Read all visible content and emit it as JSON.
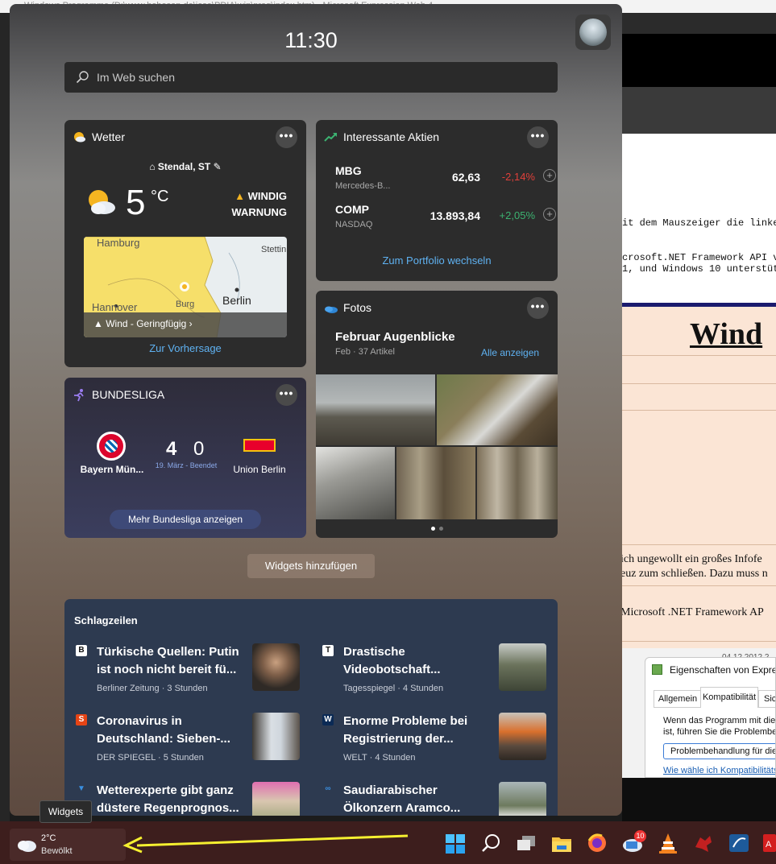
{
  "background_app": {
    "title": "Windows Programme (D:\\www.babosan.de\\jose\\PDIA\\win\\prog\\index.htm) - Microsoft Expression Web 4",
    "code_line_1": "it dem Mauszeiger die linke",
    "code_line_2": "crosoft.NET Framework API ve",
    "code_line_3": "1, und Windows 10 unterstüt:",
    "doc_heading": "Wind",
    "doc_text_1": "ich ungewollt ein großes Infofe",
    "doc_text_2": "euz zum schließen. Dazu muss n",
    "doc_text_3": "Microsoft .NET Framework AP",
    "doc_date": "04.12.2012 2",
    "dialog": {
      "title": "Eigenschaften von Expres",
      "tabs": [
        "Allgemein",
        "Kompatibilität",
        "Sich"
      ],
      "text_1": "Wenn das Programm mit diese",
      "text_2": "ist, führen Sie die Problembeh",
      "button": "Problembehandlung für die P",
      "link": "Wie wähle ich Kompatibilitätse"
    }
  },
  "panel": {
    "time": "11:30",
    "search_placeholder": "Im Web suchen",
    "weather": {
      "title": "Wetter",
      "location": "Stendal, ST",
      "temperature": "5",
      "unit": "°C",
      "warning_line_1": "WINDIG",
      "warning_line_2": "WARNUNG",
      "map_labels": [
        "Hamburg",
        "Stettin",
        "Hannover",
        "Burg",
        "Berlin"
      ],
      "alert": "Wind - Geringfügig",
      "link": "Zur Vorhersage"
    },
    "stocks": {
      "title": "Interessante Aktien",
      "rows": [
        {
          "symbol": "MBG",
          "name": "Mercedes-B...",
          "price": "62,63",
          "change": "-2,14%",
          "color": "#e0403a"
        },
        {
          "symbol": "COMP",
          "name": "NASDAQ",
          "price": "13.893,84",
          "change": "+2,05%",
          "color": "#3cb371"
        }
      ],
      "link": "Zum Portfolio wechseln"
    },
    "photos": {
      "title": "Fotos",
      "album": "Februar Augenblicke",
      "meta": "Feb · 37 Artikel",
      "link": "Alle anzeigen"
    },
    "bundesliga": {
      "title": "BUNDESLIGA",
      "home_team": "Bayern Mün...",
      "away_team": "Union Berlin",
      "home_score": "4",
      "away_score": "0",
      "status": "19. März - Beendet",
      "button": "Mehr Bundesliga anzeigen"
    },
    "add_widgets": "Widgets hinzufügen",
    "news": {
      "title": "Schlagzeilen",
      "items": [
        {
          "headline": "Türkische Quellen: Putin ist noch nicht bereit fü...",
          "source": "Berliner Zeitung · 3 Stunden",
          "logo": "B"
        },
        {
          "headline": "Drastische Videobotschaft...",
          "source": "Tagesspiegel · 4 Stunden",
          "logo": "T"
        },
        {
          "headline": "Coronavirus in Deutschland: Sieben-...",
          "source": "DER SPIEGEL · 5 Stunden",
          "logo": "S"
        },
        {
          "headline": "Enorme Probleme bei Registrierung der...",
          "source": "WELT · 4 Stunden",
          "logo": "W"
        },
        {
          "headline": "Wetterexperte gibt ganz düstere Regenprognos...",
          "source": "",
          "logo": "▼"
        },
        {
          "headline": "Saudiarabischer Ölkonzern Aramco...",
          "source": "",
          "logo": "∞"
        }
      ]
    }
  },
  "taskbar": {
    "tooltip": "Widgets",
    "weather_temp": "2°C",
    "weather_desc": "Bewölkt",
    "mail_badge": "10",
    "icons": [
      "start-icon",
      "search-icon",
      "task-view-icon",
      "file-explorer-icon",
      "firefox-icon",
      "mail-icon",
      "vlc-icon",
      "game-icon",
      "app-icon",
      "acrobat-icon"
    ]
  },
  "annotation_color": "#f5f030"
}
